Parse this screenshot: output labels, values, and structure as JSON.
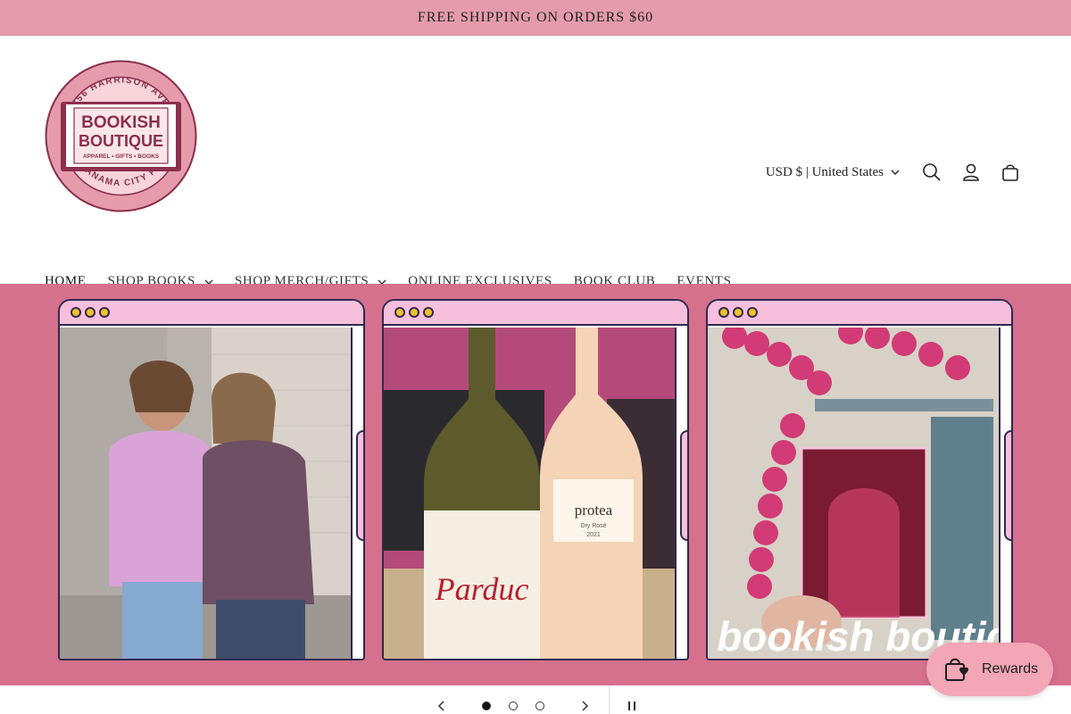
{
  "announcement": {
    "text": "FREE SHIPPING ON ORDERS $60"
  },
  "logo": {
    "name_line1": "BOOKISH",
    "name_line2": "BOUTIQUE",
    "tagline": "APPAREL • GIFTS • BOOKS",
    "top_arc": "456 HARRISON AVE",
    "bottom_arc": "PANAMA CITY FL",
    "colors": {
      "ring": "#e59bab",
      "ink": "#8c2f4d"
    }
  },
  "header": {
    "currency_label": "USD $ | United States",
    "icons": [
      "search-icon",
      "account-icon",
      "cart-icon"
    ]
  },
  "nav": {
    "items": [
      {
        "label": "HOME",
        "active": true
      },
      {
        "label": "SHOP BOOKS",
        "dropdown": true
      },
      {
        "label": "SHOP MERCH/GIFTS",
        "dropdown": true
      },
      {
        "label": "ONLINE EXCLUSIVES"
      },
      {
        "label": "BOOK CLUB"
      },
      {
        "label": "EVENTS"
      }
    ]
  },
  "hero": {
    "background": "#d5708d",
    "panels": [
      {
        "subject": "two women in graphic t-shirts against a brick wall"
      },
      {
        "subject": "two wine bottles",
        "labels": [
          "Parduc",
          "protea",
          "Dry Rosé",
          "2021"
        ]
      },
      {
        "subject": "pink balloon arch with books holding a card",
        "overlay_text": "bookish boutiq"
      }
    ]
  },
  "slider": {
    "slides_total": 3,
    "current": 1
  },
  "rewards": {
    "label": "Rewards"
  }
}
